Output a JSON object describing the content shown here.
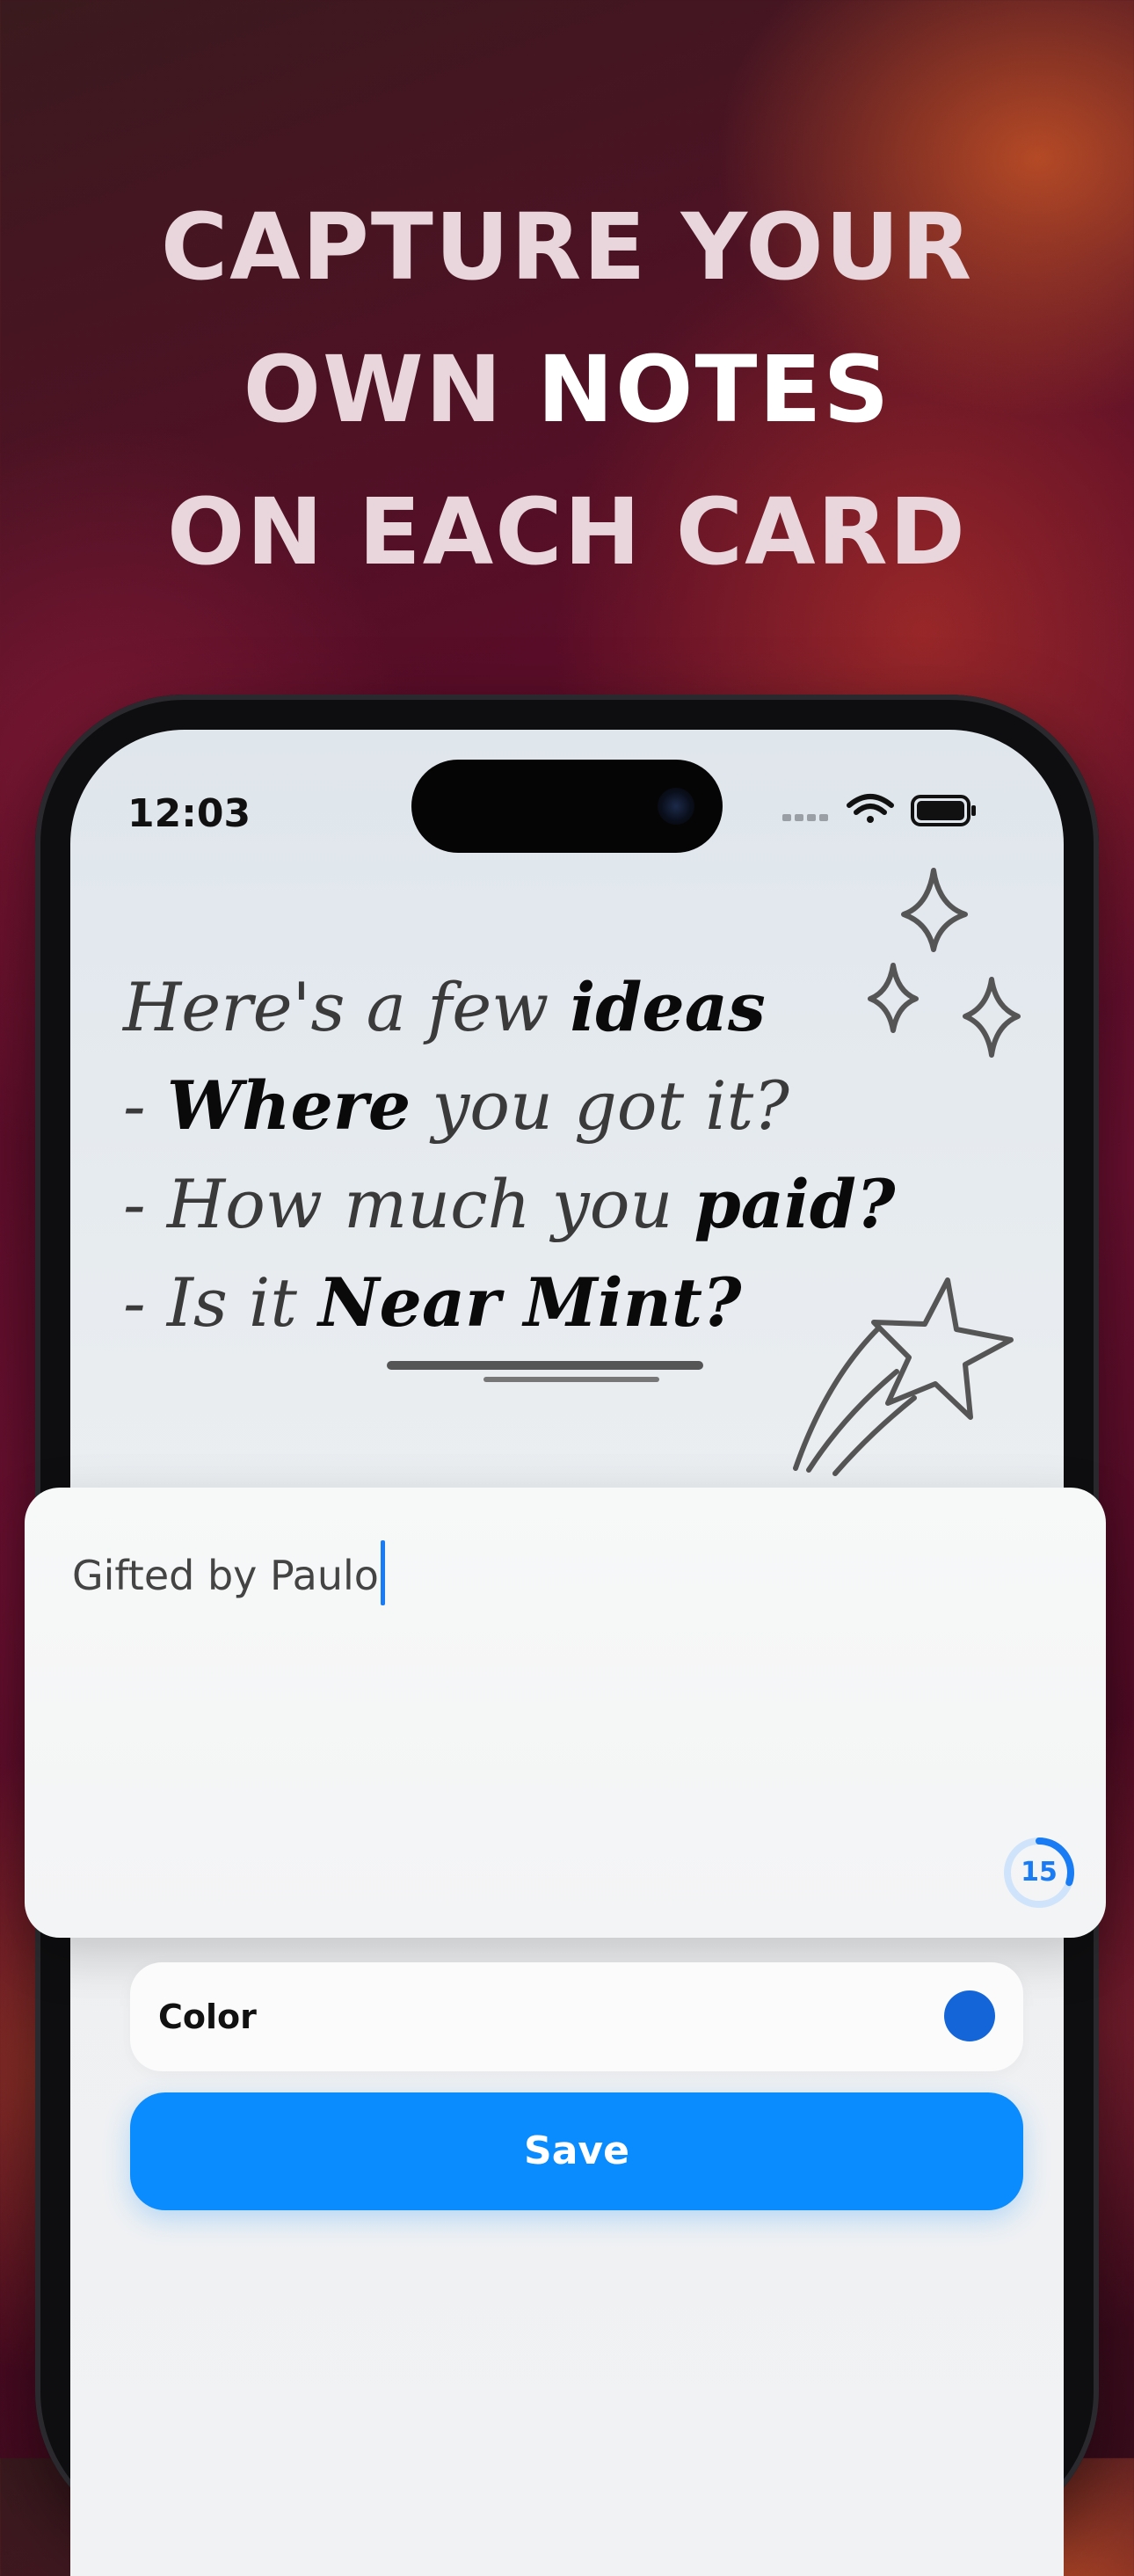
{
  "headline": {
    "line1": "CAPTURE YOUR",
    "line2_normal": "OWN ",
    "line2_bold": "NOTES",
    "line3": "ON EACH CARD"
  },
  "status_bar": {
    "time": "12:03",
    "icons": [
      "signal-icon",
      "wifi-icon",
      "battery-icon"
    ]
  },
  "handwritten_notes": {
    "line1_a": "Here's a few ",
    "line1_b": "ideas",
    "line2_a": "- ",
    "line2_b": "Where",
    "line2_c": " you got it?",
    "line3_a": "- How much you ",
    "line3_b": "paid?",
    "line4_a": "- Is it ",
    "line4_b": "Near Mint?"
  },
  "note_editor": {
    "value": "Gifted by Paulo",
    "char_counter": "15",
    "counter_progress": 0.3
  },
  "color_setting": {
    "label": "Color",
    "value_color": "#1466d8"
  },
  "save_button": {
    "label": "Save",
    "color": "#0a8bfe"
  }
}
